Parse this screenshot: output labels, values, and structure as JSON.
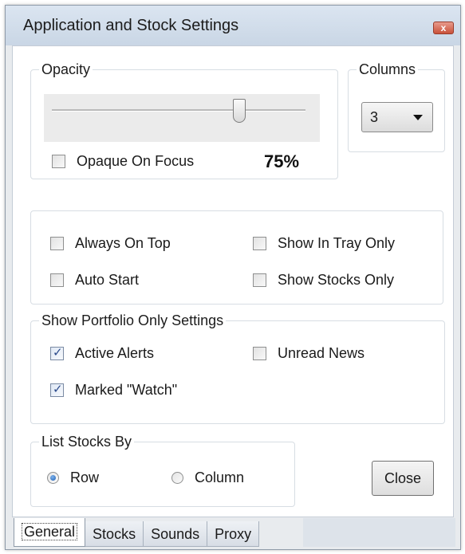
{
  "window": {
    "title": "Application and Stock Settings",
    "close_glyph": "x"
  },
  "opacity_group": {
    "legend": "Opacity",
    "slider_value": 0.75,
    "opaque_on_focus": {
      "label": "Opaque On Focus",
      "checked": false
    },
    "percent_text": "75%"
  },
  "columns_group": {
    "legend": "Columns",
    "selected": "3"
  },
  "general_options": {
    "always_on_top": {
      "label": "Always On Top",
      "checked": false
    },
    "auto_start": {
      "label": "Auto Start",
      "checked": false
    },
    "show_in_tray_only": {
      "label": "Show In Tray Only",
      "checked": false
    },
    "show_stocks_only": {
      "label": "Show Stocks Only",
      "checked": false
    }
  },
  "portfolio_group": {
    "legend": "Show Portfolio Only Settings",
    "active_alerts": {
      "label": "Active Alerts",
      "checked": true
    },
    "unread_news": {
      "label": "Unread News",
      "checked": false
    },
    "marked_watch": {
      "label": "Marked \"Watch\"",
      "checked": true
    }
  },
  "list_by_group": {
    "legend": "List Stocks By",
    "row": {
      "label": "Row",
      "selected": true
    },
    "column": {
      "label": "Column",
      "selected": false
    }
  },
  "close_button": "Close",
  "tabs": [
    {
      "label": "General",
      "active": true
    },
    {
      "label": "Stocks",
      "active": false
    },
    {
      "label": "Sounds",
      "active": false
    },
    {
      "label": "Proxy",
      "active": false
    }
  ],
  "colors": {
    "accent_radio": "#1d5fb4",
    "check_mark": "#2b4a8b",
    "window_bg": "#e8ebee"
  }
}
